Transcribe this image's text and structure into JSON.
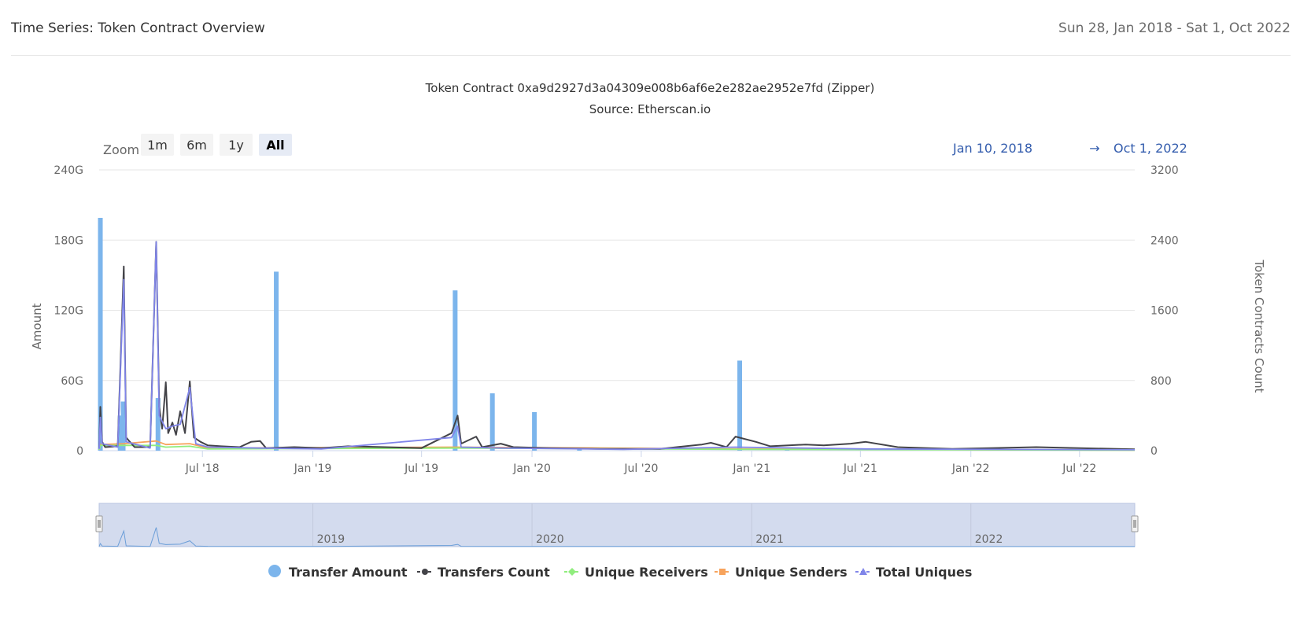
{
  "header": {
    "title": "Time Series: Token Contract Overview",
    "date_range": "Sun 28, Jan 2018 - Sat 1, Oct 2022"
  },
  "toolbar": {
    "zoom_label": "Zoom",
    "buttons": [
      "1m",
      "6m",
      "1y",
      "All"
    ],
    "active": "All",
    "range_from": "Jan 10, 2018",
    "range_arrow": "→",
    "range_to": "Oct 1, 2022"
  },
  "chart_data": {
    "type": "line",
    "title": "Token Contract 0xa9d2927d3a04309e008b6af6e2e282ae2952e7fd (Zipper)",
    "subtitle": "Source: Etherscan.io",
    "x_range": [
      "2018-01-10",
      "2022-10-01"
    ],
    "x_tick_labels": [
      "Jul '18",
      "Jan '19",
      "Jul '19",
      "Jan '20",
      "Jul '20",
      "Jan '21",
      "Jul '21",
      "Jan '22",
      "Jul '22"
    ],
    "x_tick_dates": [
      "2018-07-01",
      "2019-01-01",
      "2019-07-01",
      "2020-01-01",
      "2020-07-01",
      "2021-01-01",
      "2021-07-01",
      "2022-01-01",
      "2022-07-01"
    ],
    "y_left": {
      "label": "Amount",
      "ticks": [
        "0",
        "60G",
        "120G",
        "180G",
        "240G"
      ],
      "tick_values": [
        0,
        60,
        120,
        180,
        240
      ],
      "range": [
        0,
        240
      ],
      "unit": "G"
    },
    "y_right": {
      "label": "Token Contracts Count",
      "ticks": [
        "0",
        "800",
        "1600",
        "2400",
        "3200"
      ],
      "tick_values": [
        0,
        800,
        1600,
        2400,
        3200
      ],
      "range": [
        0,
        3200
      ]
    },
    "grid": true,
    "legend_position": "bottom",
    "series": [
      {
        "name": "Transfer Amount",
        "type": "column",
        "axis": "left",
        "color": "#7cb5ec",
        "data": [
          [
            "2018-01-12",
            199
          ],
          [
            "2018-02-14",
            30
          ],
          [
            "2018-02-19",
            42
          ],
          [
            "2018-04-18",
            45
          ],
          [
            "2018-11-01",
            153
          ],
          [
            "2019-08-26",
            137
          ],
          [
            "2019-10-27",
            49
          ],
          [
            "2020-01-05",
            33
          ],
          [
            "2020-12-12",
            77
          ],
          [
            "2020-03-20",
            1
          ],
          [
            "2021-03-01",
            0.5
          ]
        ]
      },
      {
        "name": "Transfers Count",
        "type": "line",
        "axis": "right",
        "color": "#434348",
        "data": [
          [
            "2018-01-10",
            30
          ],
          [
            "2018-01-12",
            500
          ],
          [
            "2018-01-15",
            100
          ],
          [
            "2018-01-20",
            40
          ],
          [
            "2018-02-10",
            50
          ],
          [
            "2018-02-20",
            2100
          ],
          [
            "2018-02-24",
            150
          ],
          [
            "2018-03-10",
            40
          ],
          [
            "2018-04-05",
            40
          ],
          [
            "2018-04-15",
            2380
          ],
          [
            "2018-04-20",
            500
          ],
          [
            "2018-04-25",
            250
          ],
          [
            "2018-05-01",
            780
          ],
          [
            "2018-05-05",
            200
          ],
          [
            "2018-05-12",
            320
          ],
          [
            "2018-05-18",
            180
          ],
          [
            "2018-05-25",
            450
          ],
          [
            "2018-06-02",
            200
          ],
          [
            "2018-06-10",
            790
          ],
          [
            "2018-06-17",
            150
          ],
          [
            "2018-06-28",
            100
          ],
          [
            "2018-07-10",
            60
          ],
          [
            "2018-08-01",
            50
          ],
          [
            "2018-09-01",
            40
          ],
          [
            "2018-09-20",
            100
          ],
          [
            "2018-10-05",
            110
          ],
          [
            "2018-10-15",
            30
          ],
          [
            "2018-12-01",
            40
          ],
          [
            "2019-01-15",
            30
          ],
          [
            "2019-03-01",
            50
          ],
          [
            "2019-05-01",
            40
          ],
          [
            "2019-07-01",
            30
          ],
          [
            "2019-08-20",
            200
          ],
          [
            "2019-08-30",
            400
          ],
          [
            "2019-09-05",
            80
          ],
          [
            "2019-09-30",
            160
          ],
          [
            "2019-10-10",
            40
          ],
          [
            "2019-11-10",
            80
          ],
          [
            "2019-12-01",
            40
          ],
          [
            "2020-02-01",
            30
          ],
          [
            "2020-05-01",
            20
          ],
          [
            "2020-08-01",
            20
          ],
          [
            "2020-10-10",
            70
          ],
          [
            "2020-10-25",
            90
          ],
          [
            "2020-11-20",
            40
          ],
          [
            "2020-12-05",
            160
          ],
          [
            "2021-01-08",
            100
          ],
          [
            "2021-02-01",
            50
          ],
          [
            "2021-04-01",
            70
          ],
          [
            "2021-05-01",
            60
          ],
          [
            "2021-06-15",
            80
          ],
          [
            "2021-07-10",
            100
          ],
          [
            "2021-09-01",
            40
          ],
          [
            "2021-12-01",
            20
          ],
          [
            "2022-04-20",
            40
          ],
          [
            "2022-09-01",
            20
          ],
          [
            "2022-10-01",
            15
          ]
        ]
      },
      {
        "name": "Unique Receivers",
        "type": "line",
        "axis": "right",
        "color": "#90ed7d",
        "data": [
          [
            "2018-01-10",
            10
          ],
          [
            "2018-01-12",
            60
          ],
          [
            "2018-02-20",
            60
          ],
          [
            "2018-04-15",
            60
          ],
          [
            "2018-05-01",
            40
          ],
          [
            "2018-06-10",
            50
          ],
          [
            "2018-07-10",
            20
          ],
          [
            "2019-08-30",
            30
          ],
          [
            "2020-12-05",
            15
          ],
          [
            "2022-10-01",
            5
          ]
        ]
      },
      {
        "name": "Unique Senders",
        "type": "line",
        "axis": "right",
        "color": "#f7a35c",
        "data": [
          [
            "2018-01-10",
            10
          ],
          [
            "2018-01-12",
            70
          ],
          [
            "2018-02-20",
            80
          ],
          [
            "2018-04-15",
            110
          ],
          [
            "2018-05-01",
            70
          ],
          [
            "2018-06-10",
            80
          ],
          [
            "2018-07-10",
            30
          ],
          [
            "2019-08-30",
            40
          ],
          [
            "2020-12-05",
            20
          ],
          [
            "2022-10-01",
            5
          ]
        ]
      },
      {
        "name": "Total Uniques",
        "type": "line",
        "axis": "right",
        "color": "#8085e9",
        "data": [
          [
            "2018-01-10",
            20
          ],
          [
            "2018-01-12",
            380
          ],
          [
            "2018-01-15",
            80
          ],
          [
            "2018-02-10",
            40
          ],
          [
            "2018-02-20",
            1950
          ],
          [
            "2018-02-24",
            100
          ],
          [
            "2018-04-05",
            30
          ],
          [
            "2018-04-15",
            2380
          ],
          [
            "2018-04-20",
            400
          ],
          [
            "2018-05-01",
            250
          ],
          [
            "2018-05-12",
            280
          ],
          [
            "2018-05-25",
            300
          ],
          [
            "2018-06-10",
            720
          ],
          [
            "2018-06-20",
            80
          ],
          [
            "2018-07-10",
            40
          ],
          [
            "2018-10-05",
            30
          ],
          [
            "2019-01-15",
            20
          ],
          [
            "2019-08-20",
            150
          ],
          [
            "2019-08-30",
            280
          ],
          [
            "2019-09-05",
            40
          ],
          [
            "2019-11-10",
            30
          ],
          [
            "2020-06-01",
            15
          ],
          [
            "2020-12-05",
            40
          ],
          [
            "2021-07-10",
            20
          ],
          [
            "2022-10-01",
            10
          ]
        ]
      }
    ],
    "navigator": {
      "year_labels": [
        "2019",
        "2020",
        "2021",
        "2022"
      ],
      "year_dates": [
        "2019-01-01",
        "2020-01-01",
        "2021-01-01",
        "2022-01-01"
      ]
    },
    "legend": [
      "Transfer Amount",
      "Transfers Count",
      "Unique Receivers",
      "Unique Senders",
      "Total Uniques"
    ]
  }
}
